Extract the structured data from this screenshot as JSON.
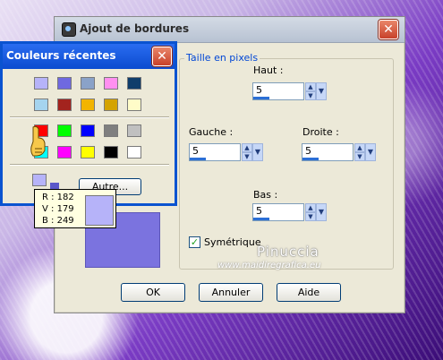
{
  "dialog": {
    "title": "Ajout de bordures",
    "group_label": "Taille en pixels",
    "haut_label": "Haut :",
    "haut_value": "5",
    "gauche_label": "Gauche :",
    "gauche_value": "5",
    "droite_label": "Droite :",
    "droite_value": "5",
    "bas_label": "Bas :",
    "bas_value": "5",
    "symetrique_label": "Symétrique",
    "symetrique_checked": true,
    "preview_color": "#7b73df",
    "buttons": {
      "ok": "OK",
      "cancel": "Annuler",
      "help": "Aide"
    }
  },
  "watermark": {
    "name": "Pinuccia",
    "url": "www.maidiregrafica.eu"
  },
  "recent_colors": {
    "title": "Couleurs récentes",
    "row1": [
      "#b6b3f9",
      "#6f69e0",
      "#8aa2c8",
      "#ff8ff0",
      "#0f3d6b"
    ],
    "row2": [
      "#a5d4ef",
      "#a3231e",
      "#f2b400",
      "#d4a300",
      "#fffcc8"
    ],
    "row3": [
      "#ff0000",
      "#00ff00",
      "#0000ff",
      "#7f7f7f",
      "#c0c0c0"
    ],
    "row4": [
      "#00ffff",
      "#ff00ff",
      "#ffff00",
      "#000000",
      "#ffffff"
    ],
    "current_color": "#b6b3f9",
    "other_button": "Autre..."
  },
  "tooltip": {
    "r": "R : 182",
    "v": "V : 179",
    "b": "B : 249",
    "color": "#b6b3f9"
  }
}
